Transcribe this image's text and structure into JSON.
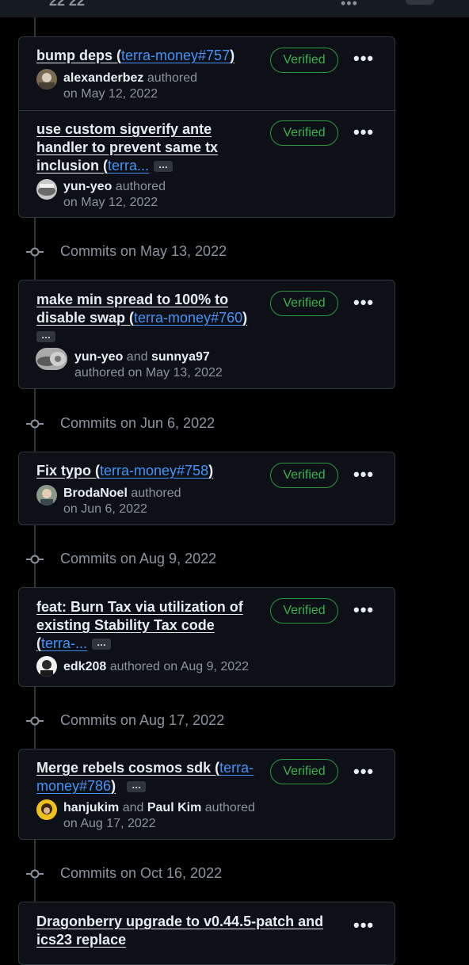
{
  "topbar": {
    "partial_text": "22 22",
    "menu": "•••"
  },
  "groups": [
    {
      "label": "Commits on May 13, 2022"
    },
    {
      "label": "Commits on Jun 6, 2022"
    },
    {
      "label": "Commits on Aug 9, 2022"
    },
    {
      "label": "Commits on Aug 17, 2022"
    },
    {
      "label": "Commits on Oct 16, 2022"
    }
  ],
  "commits": [
    {
      "title": "bump deps (",
      "link": "terra-money#757",
      "title_end": ")",
      "badge": "Verified",
      "author": "alexanderbez",
      "verb": "authored",
      "date": "on May 12, 2022"
    },
    {
      "title_line1": "use custom sigverify ante",
      "title_line2": "handler to prevent same tx",
      "title_line3": "inclusion (",
      "link": "terra...",
      "ellipsis": "…",
      "badge": "Verified",
      "author": "yun-yeo",
      "verb": "authored",
      "date": "on May 12, 2022"
    },
    {
      "title_line1": "make min spread to 100% to",
      "title_line2": "disable swap (",
      "link": "terra-money#760",
      "title_end": ")",
      "ellipsis": "…",
      "badge": "Verified",
      "author": "yun-yeo",
      "and": "and",
      "coauthor": "sunnya97",
      "date": "authored on May 13, 2022"
    },
    {
      "title": "Fix typo (",
      "link": "terra-money#758",
      "title_end": ")",
      "badge": "Verified",
      "author": "BrodaNoel",
      "verb": "authored",
      "date": "on Jun 6, 2022"
    },
    {
      "title_line1": "feat: Burn Tax via utilization of",
      "title_line2": "existing Stability Tax code",
      "title_line3": "(",
      "link": "terra-...",
      "ellipsis": "…",
      "badge": "Verified",
      "author": "edk208",
      "date": "authored on Aug 9, 2022"
    },
    {
      "title_line1": "Merge rebels cosmos sdk (",
      "link1": "terra-",
      "link2": "money#786",
      "title_end": ")",
      "ellipsis": "…",
      "badge": "Verified",
      "author": "hanjukim",
      "and": "and",
      "coauthor": "Paul Kim",
      "verb": "authored",
      "date": "on Aug 17, 2022"
    },
    {
      "title_line1": "Dragonberry upgrade to v0.44.5-patch and",
      "title_line2": "ics23 replace"
    }
  ],
  "more_label": "•••",
  "colors": {
    "verified": "#3fb950",
    "link": "#4493f8",
    "border": "#30363d",
    "muted": "#8b949e"
  }
}
